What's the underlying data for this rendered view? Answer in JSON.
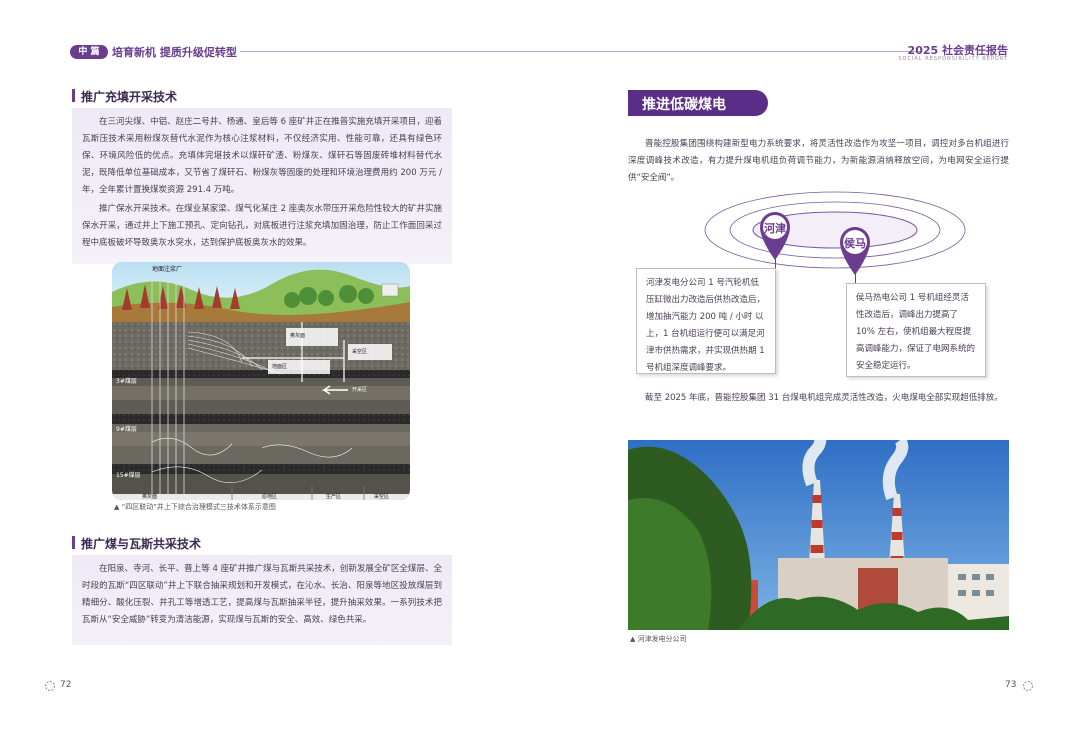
{
  "header": {
    "tag": "中 篇",
    "left_title": "培育新机  提质升级促转型",
    "right_title": "2025 社会责任报告",
    "right_sub": "SOCIAL RESPONSIBILITY REPORT"
  },
  "left": {
    "sec1": {
      "title": "推广充填开采技术",
      "p1": "在三河尖煤、中铝、赵庄二号井、杨通、皇后等 6 座矿井正在推普实施充填开采项目，迎着瓦斯压技术采用粉煤灰替代水泥作为核心注浆材料，不仅经济实用、性能可靠，还具有绿色环保、环境风险低的优点。充填体完堪技术以煤矸矿渣、粉煤灰、煤矸石等固废砖堆材料替代水泥，既降低单位基础成本，又节省了煤矸石、粉煤灰等固废的处理和环境治理费用约 200 万元 / 年，全年累计置换煤炭资源 291.4 万吨。",
      "p2": "推广保水开采技术。在煤业某家梁、煤气化某庄 2 座奥灰水带压开采危险性较大的矿井实施保水开采，通过井上下施工预孔、定向钻孔，对底板进行注浆充填加固治理，防止工作面回采过程中底板破坏导致奥灰水突水，达到保护底板奥灰水的效果。"
    },
    "diagram": {
      "label_factory": "地面注浆厂",
      "label_coal3": "3#煤层",
      "label_coal9": "9#煤层",
      "label_coal15": "15#煤层",
      "tag_a": "奥灰面",
      "tag_b": "地面区",
      "tag_c": "采空区",
      "tag_d": "开采区",
      "bottom_1": "奥灰面",
      "bottom_2": "原地区",
      "bottom_3": "生产区",
      "bottom_4": "采空区"
    },
    "diagram_caption": "▲ “四区联动”井上下综合治理模式三技术体系示意图",
    "sec2": {
      "title": "推广煤与瓦斯共采技术",
      "p1": "在阳泉、寺河、长平、晋上等 4 座矿井推广煤与瓦斯共采技术，创新发展全矿区全煤层、全时段的瓦斯“四区联动”井上下联合抽采规划和开发模式，在沁水、长治、阳泉等地区投放煤层到精细分、酸化压裂、井孔工等增透工艺，提高煤与瓦斯抽采半径，提升抽采效果。一系列技术把瓦斯从“安全威胁”转变为清洁能源，实现煤与瓦斯的安全、高效、绿色共采。"
    },
    "page_number": "72"
  },
  "right": {
    "banner": "推进低碳煤电",
    "intro": "晋能控股集团围绕构建新型电力系统要求，将灵活性改造作为攻坚一项目，调控对多台机组进行深度调峰技术改造，有力提升煤电机组负荷调节能力，为新能源消纳释放空间，为电网安全运行提供“安全阀”。",
    "map_label_1": "河津",
    "map_label_2": "侯马",
    "callout_1": "河津发电分公司 1 号汽轮机低压缸微出力改造后供热改造后，增加抽汽能力 200 吨 / 小时 以上，1 台机组运行便可以满足河津市供热需求，并实现供热期 1 号机组深度调峰要求。",
    "callout_2": "侯马热电公司 1 号机组经灵活性改造后，调峰出力提高了 10% 左右，使机组最大程度提高调峰能力，保证了电网系统的安全稳定运行。",
    "outro": "截至 2025 年底，晋能控股集团 31 台煤电机组完成灵活性改造，火电煤电全部实现超低排放。",
    "photo_caption": "▲ 河津发电分公司",
    "page_number": "73"
  }
}
